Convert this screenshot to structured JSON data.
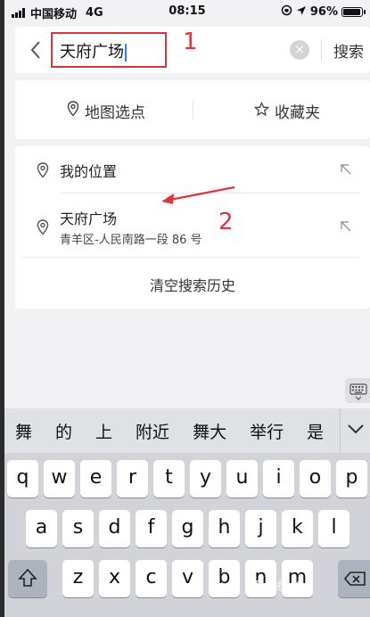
{
  "status_bar": {
    "carrier": "中国移动",
    "network": "4G",
    "time": "08:15",
    "battery": "96%",
    "battery_level": 0.96
  },
  "search": {
    "query": "天府广场",
    "annotation_1": "1",
    "search_label": "搜索"
  },
  "options": {
    "map_pick_label": "地图选点",
    "favorites_label": "收藏夹"
  },
  "history": {
    "my_location_label": "我的位置",
    "items": [
      {
        "name": "天府广场",
        "address": "青羊区-人民南路一段 86 号"
      }
    ],
    "annotation_2": "2",
    "clear_label": "清空搜索历史"
  },
  "keyboard": {
    "candidates": [
      "舞",
      "的",
      "上",
      "附近",
      "舞大",
      "举行",
      "是"
    ],
    "row1": [
      "q",
      "w",
      "e",
      "r",
      "t",
      "y",
      "u",
      "i",
      "o",
      "p"
    ],
    "row2": [
      "a",
      "s",
      "d",
      "f",
      "g",
      "h",
      "j",
      "k",
      "l"
    ],
    "row3": [
      "z",
      "x",
      "c",
      "v",
      "b",
      "n",
      "m"
    ]
  },
  "watermark": "Bai经验",
  "colors": {
    "annotation_red": "#e2333b",
    "caret_blue": "#2a7cff"
  }
}
